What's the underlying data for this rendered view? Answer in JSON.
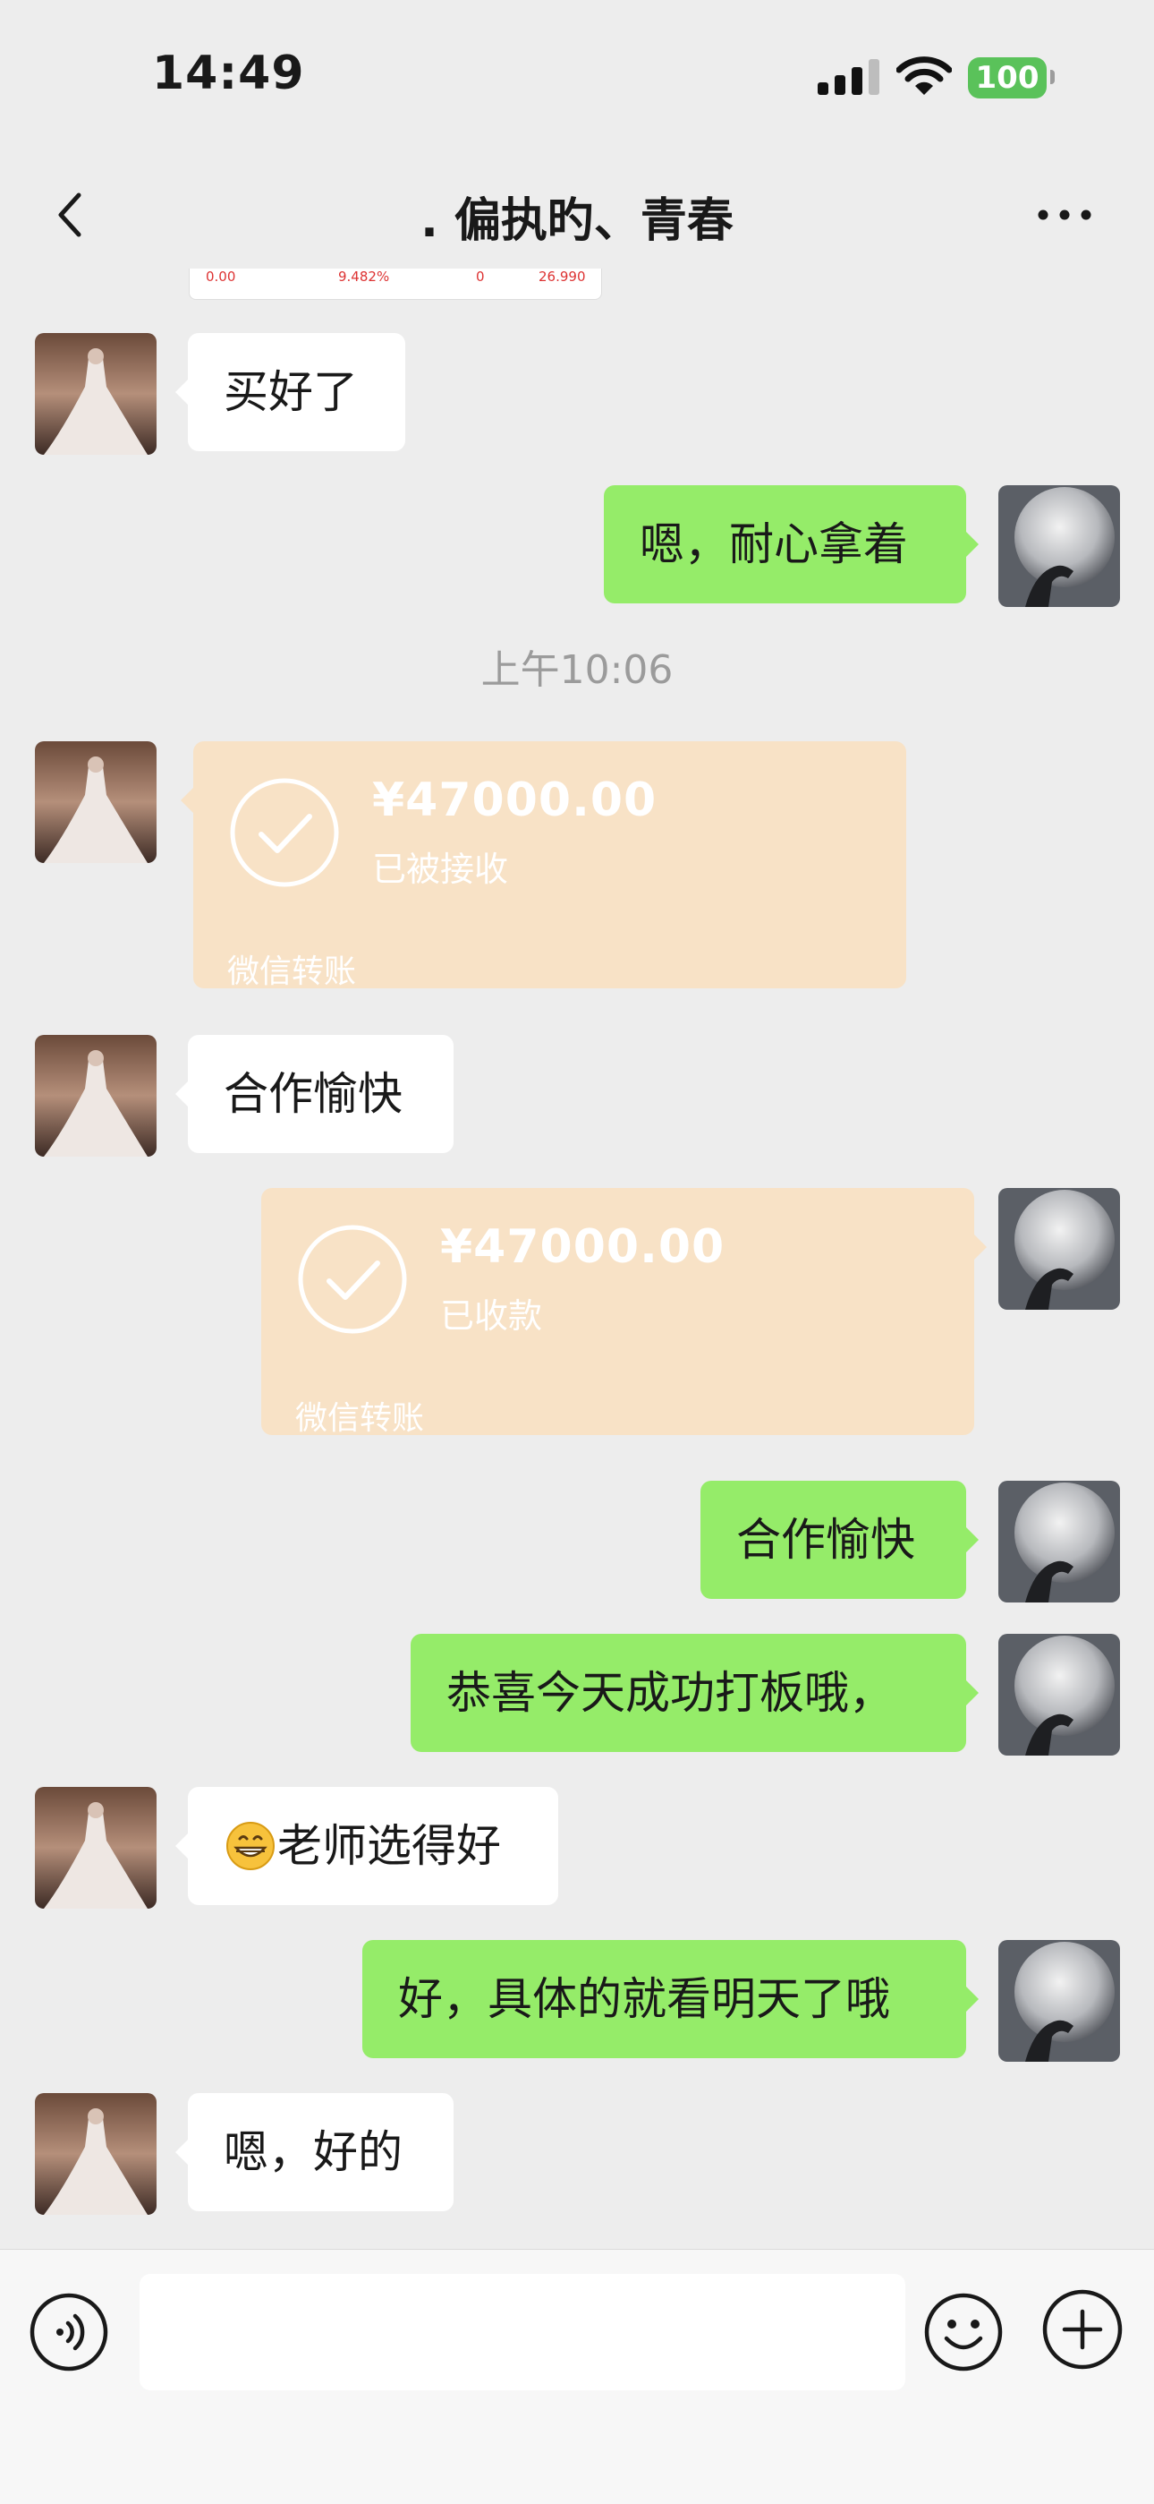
{
  "status_bar": {
    "time": "14:49",
    "battery": "100"
  },
  "nav": {
    "title": ". 偏执旳、青春"
  },
  "top_image": {
    "cells": [
      "0.00",
      "9.482%",
      "0",
      "26.990"
    ]
  },
  "timestamp": "上午10:06",
  "messages": [
    {
      "side": "left",
      "type": "text",
      "text": "买好了"
    },
    {
      "side": "right",
      "type": "text",
      "text": "嗯，耐心拿着"
    },
    {
      "side": "left",
      "type": "transfer",
      "amount": "¥47000.00",
      "status": "已被接收",
      "label": "微信转账"
    },
    {
      "side": "left",
      "type": "text",
      "text": "合作愉快"
    },
    {
      "side": "right",
      "type": "transfer",
      "amount": "¥47000.00",
      "status": "已收款",
      "label": "微信转账"
    },
    {
      "side": "right",
      "type": "text",
      "text": "合作愉快"
    },
    {
      "side": "right",
      "type": "text",
      "text": "恭喜今天成功打板哦，"
    },
    {
      "side": "left",
      "type": "text",
      "emoji": "grinning-face",
      "text": "老师选得好"
    },
    {
      "side": "right",
      "type": "text",
      "text": "好，具体的就看明天了哦"
    },
    {
      "side": "left",
      "type": "text",
      "text": "嗯，好的"
    }
  ],
  "input": {
    "value": "",
    "placeholder": ""
  },
  "colors": {
    "background": "#EDEDED",
    "sent_bubble": "#95EC69",
    "received_bubble": "#FFFFFF",
    "transfer_card": "#F8E2C6",
    "battery": "#5AC25A"
  }
}
